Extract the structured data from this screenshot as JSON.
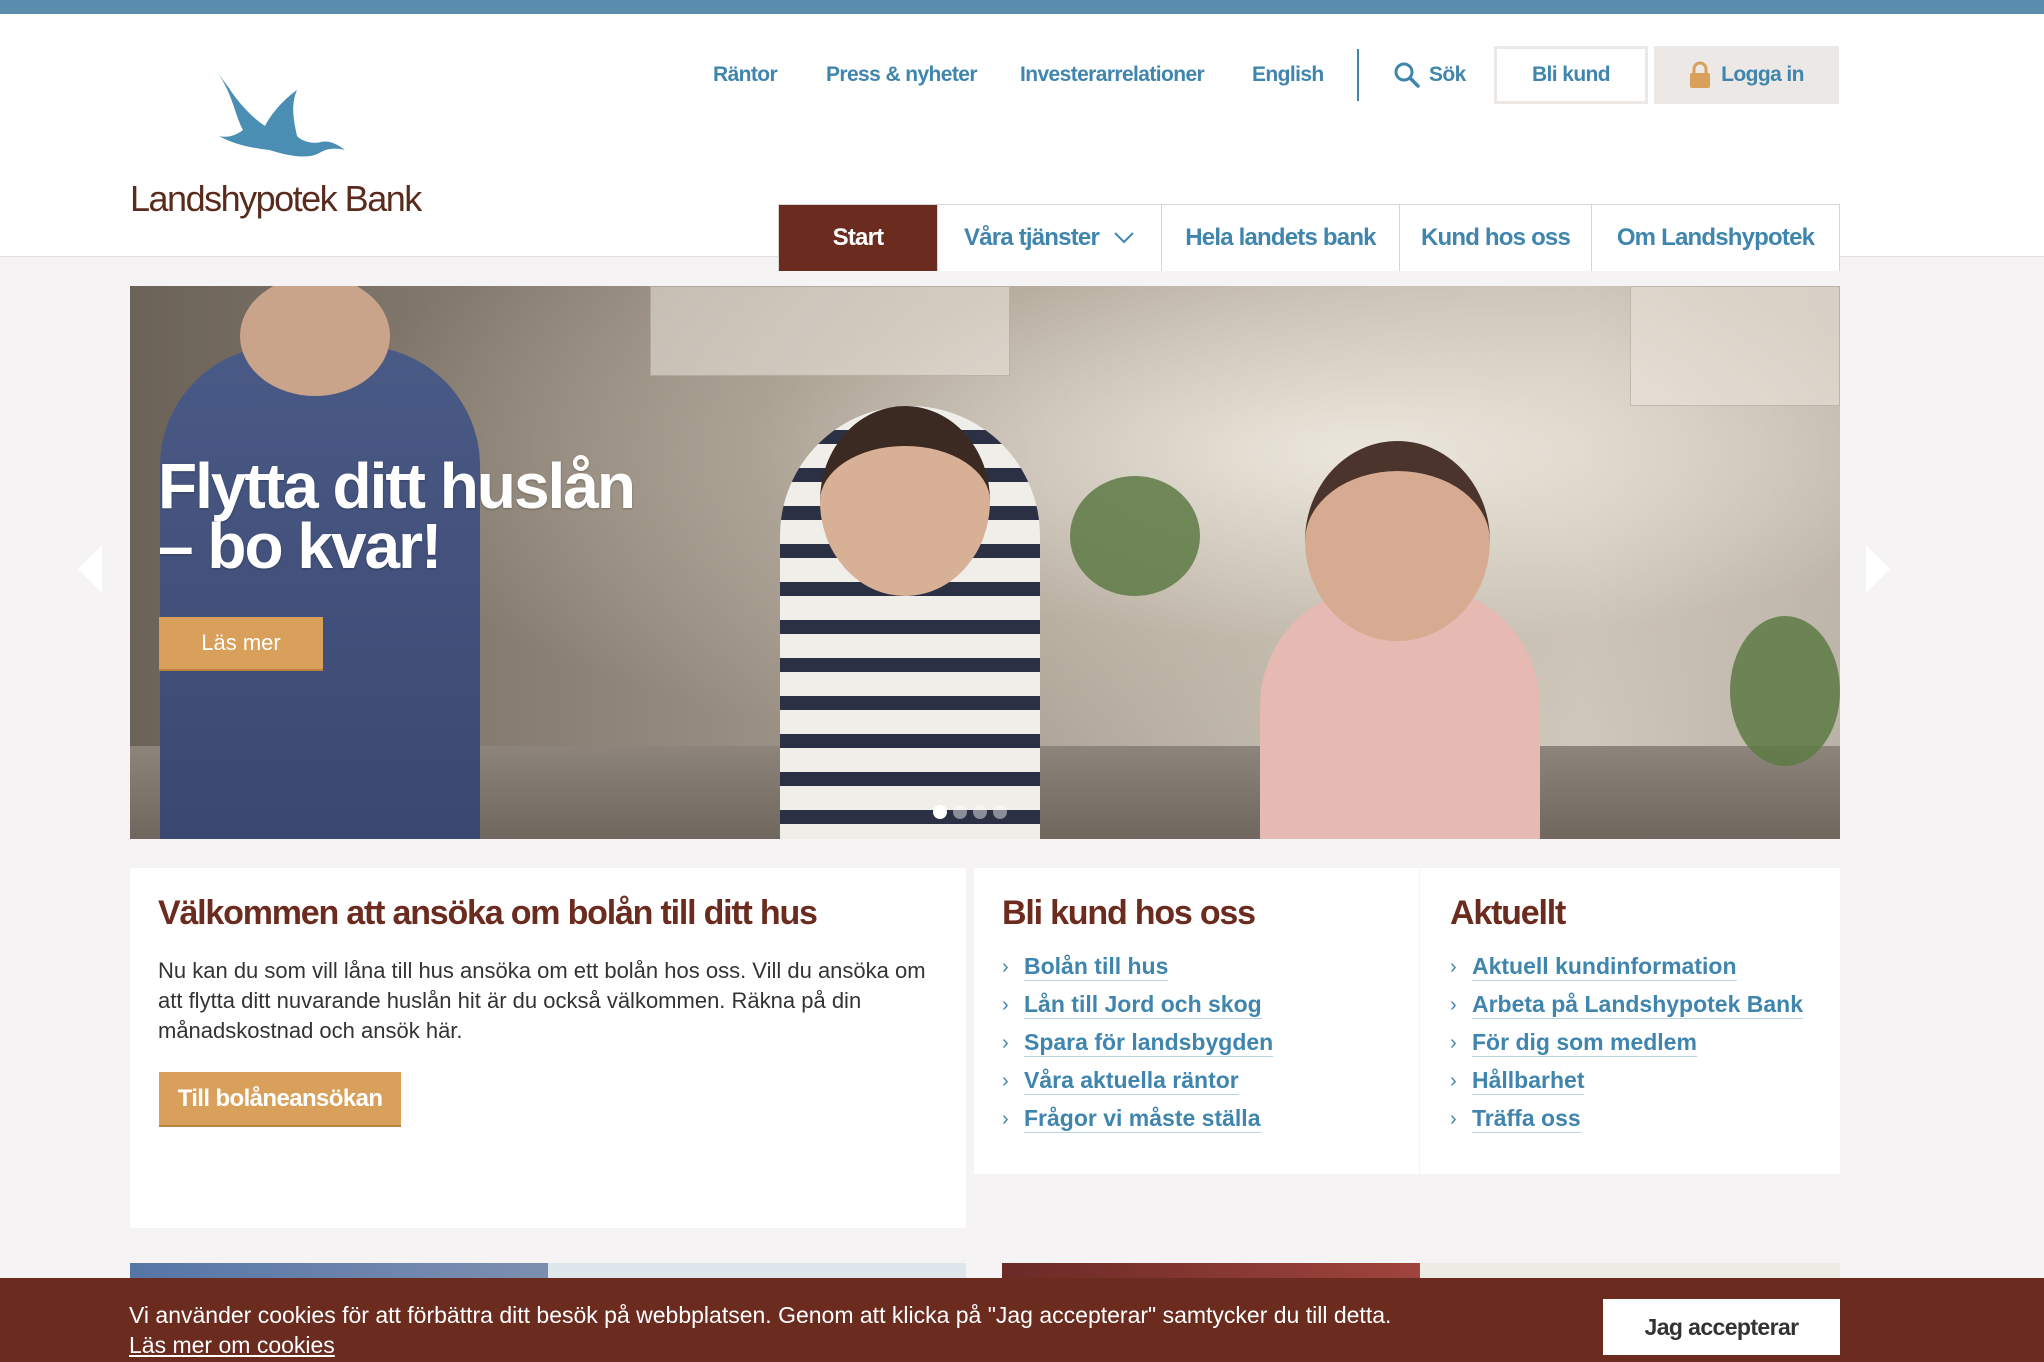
{
  "brand": {
    "name": "Landshypotek Bank",
    "color": "#6b2c1f",
    "accent": "#3f85ad",
    "cta": "#d9a05b"
  },
  "utility_nav": {
    "links": [
      "Räntor",
      "Press & nyheter",
      "Investerarrelationer",
      "English"
    ],
    "search_label": "Sök",
    "become_customer": "Bli kund",
    "login": "Logga in"
  },
  "main_nav": {
    "items": [
      "Start",
      "Våra tjänster",
      "Hela landets bank",
      "Kund hos oss",
      "Om Landshypotek"
    ],
    "active": "Start"
  },
  "hero": {
    "title_line1": "Flytta ditt huslån",
    "title_line2": "– bo kvar!",
    "button": "Läs mer",
    "slide_count": 4,
    "active_slide": 1
  },
  "welcome": {
    "heading": "Välkommen att ansöka om bolån till ditt hus",
    "body": "Nu kan du som vill låna till hus ansöka om ett bolån hos oss. Vill du ansöka om att flytta ditt nuvarande huslån hit är du också välkommen. Räkna på din månadskostnad och ansök här.",
    "button": "Till bolåneansökan"
  },
  "become_customer": {
    "heading": "Bli kund hos oss",
    "links": [
      "Bolån till hus",
      "Lån till Jord och skog",
      "Spara för landsbygden",
      "Våra aktuella räntor",
      "Frågor vi måste ställa"
    ]
  },
  "news": {
    "heading": "Aktuellt",
    "links": [
      "Aktuell kundinformation",
      "Arbeta på Landshypotek Bank",
      "För dig som medlem",
      "Hållbarhet",
      "Träffa oss"
    ]
  },
  "cookie_banner": {
    "text": "Vi använder cookies för att förbättra ditt besök på webbplatsen. Genom att klicka på \"Jag accepterar\" samtycker du till detta.",
    "more_link": "Läs mer om cookies",
    "accept": "Jag accepterar"
  }
}
